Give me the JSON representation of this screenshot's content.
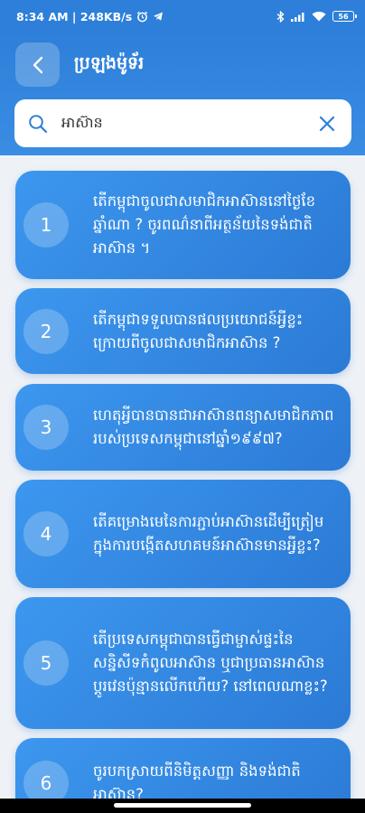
{
  "status_bar": {
    "time_speed": "8:34 AM | 248KB/s",
    "battery": "56"
  },
  "header": {
    "back_icon": "chevron-left-icon",
    "title": "ប្រឡងម៉ូទ័រ"
  },
  "search": {
    "value": "អាស៊ាន",
    "placeholder": ""
  },
  "questions": [
    {
      "number": "1",
      "text": "តើកម្ពុជាចូលជាសមាជិកអាស៊ាននៅថ្ងៃខែឆ្នាំណា ? ចូរពណ៌នាពីអត្ថន័យនៃទង់ជាតិអាស៊ាន ។"
    },
    {
      "number": "2",
      "text": "តើកម្ពុជាទទួលបានផលប្រយោជន៍អ្វីខ្លះ ក្រោយពីចូលជាសមាជិកអាស៊ាន ?"
    },
    {
      "number": "3",
      "text": "ហេតុអ្វីបានបានជាអាស៊ានពន្យាសមាជិកភាពរបស់ប្រទេសកម្ពុជានៅឆ្នាំ១៩៩៧?"
    },
    {
      "number": "4",
      "text": "តើគម្រោងមេនៃការភ្ជាប់អាស៊ានដើម្បីត្រៀមក្នុងការបង្កើតសហគមន៍អាស៊ានមានអ្វីខ្លះ?"
    },
    {
      "number": "5",
      "text": "តើប្រទេសកម្ពុជាបានធ្វើជាម្ចាស់ផ្ទះនៃសន្និសីទកំពូលអាស៊ាន ឬជាប្រធានអាស៊ានប្តូរវេនប៉ុន្មានលើកហើយ? នៅពេលណាខ្លះ?"
    },
    {
      "number": "6",
      "text": "ចូរបកស្រាយពីនិមិត្តសញ្ញា និងទង់ជាតិអាស៊ាន?"
    }
  ],
  "colors": {
    "primary": "#2d7fd9",
    "card": "#3a8de3",
    "background": "#eef2f7"
  }
}
